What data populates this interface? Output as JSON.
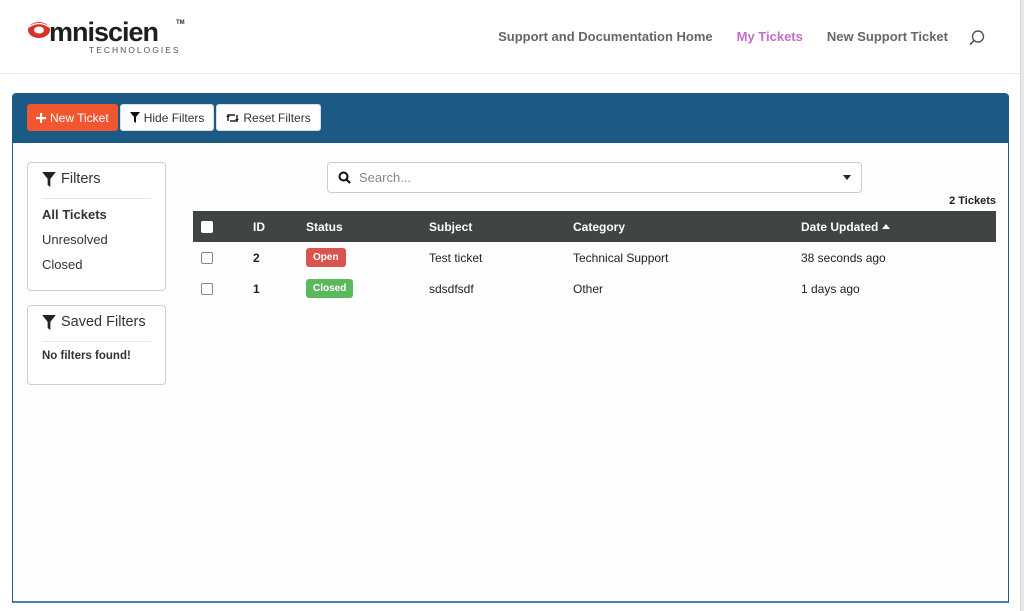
{
  "brand": {
    "name": "mniscien",
    "trademark": "TM",
    "tagline": "TECHNOLOGIES",
    "accent_color": "#d8322a"
  },
  "nav": {
    "items": [
      {
        "label": "Support and Documentation Home",
        "active": false
      },
      {
        "label": "My Tickets",
        "active": true
      },
      {
        "label": "New Support Ticket",
        "active": false
      }
    ],
    "search_icon": "search-icon",
    "active_color": "#c36dc9"
  },
  "toolbar": {
    "new_ticket_label": "New Ticket",
    "hide_filters_label": "Hide Filters",
    "reset_filters_label": "Reset Filters",
    "bg_color": "#1c5a86",
    "new_ticket_color": "#f0562f"
  },
  "filters": {
    "title": "Filters",
    "items": [
      {
        "label": "All Tickets",
        "active": true
      },
      {
        "label": "Unresolved",
        "active": false
      },
      {
        "label": "Closed",
        "active": false
      }
    ]
  },
  "saved_filters": {
    "title": "Saved Filters",
    "empty_message": "No filters found!"
  },
  "search": {
    "placeholder": "Search...",
    "value": ""
  },
  "ticket_count": "2 Tickets",
  "table": {
    "columns": [
      "ID",
      "Status",
      "Subject",
      "Category",
      "Date Updated"
    ],
    "sort_column": "Date Updated",
    "sort_direction": "asc",
    "rows": [
      {
        "id": "2",
        "status": "Open",
        "status_color": "#d9534f",
        "subject": "Test ticket",
        "category": "Technical Support",
        "date_updated": "38 seconds ago"
      },
      {
        "id": "1",
        "status": "Closed",
        "status_color": "#5cb85c",
        "subject": "sdsdfsdf",
        "category": "Other",
        "date_updated": "1 days ago"
      }
    ]
  }
}
